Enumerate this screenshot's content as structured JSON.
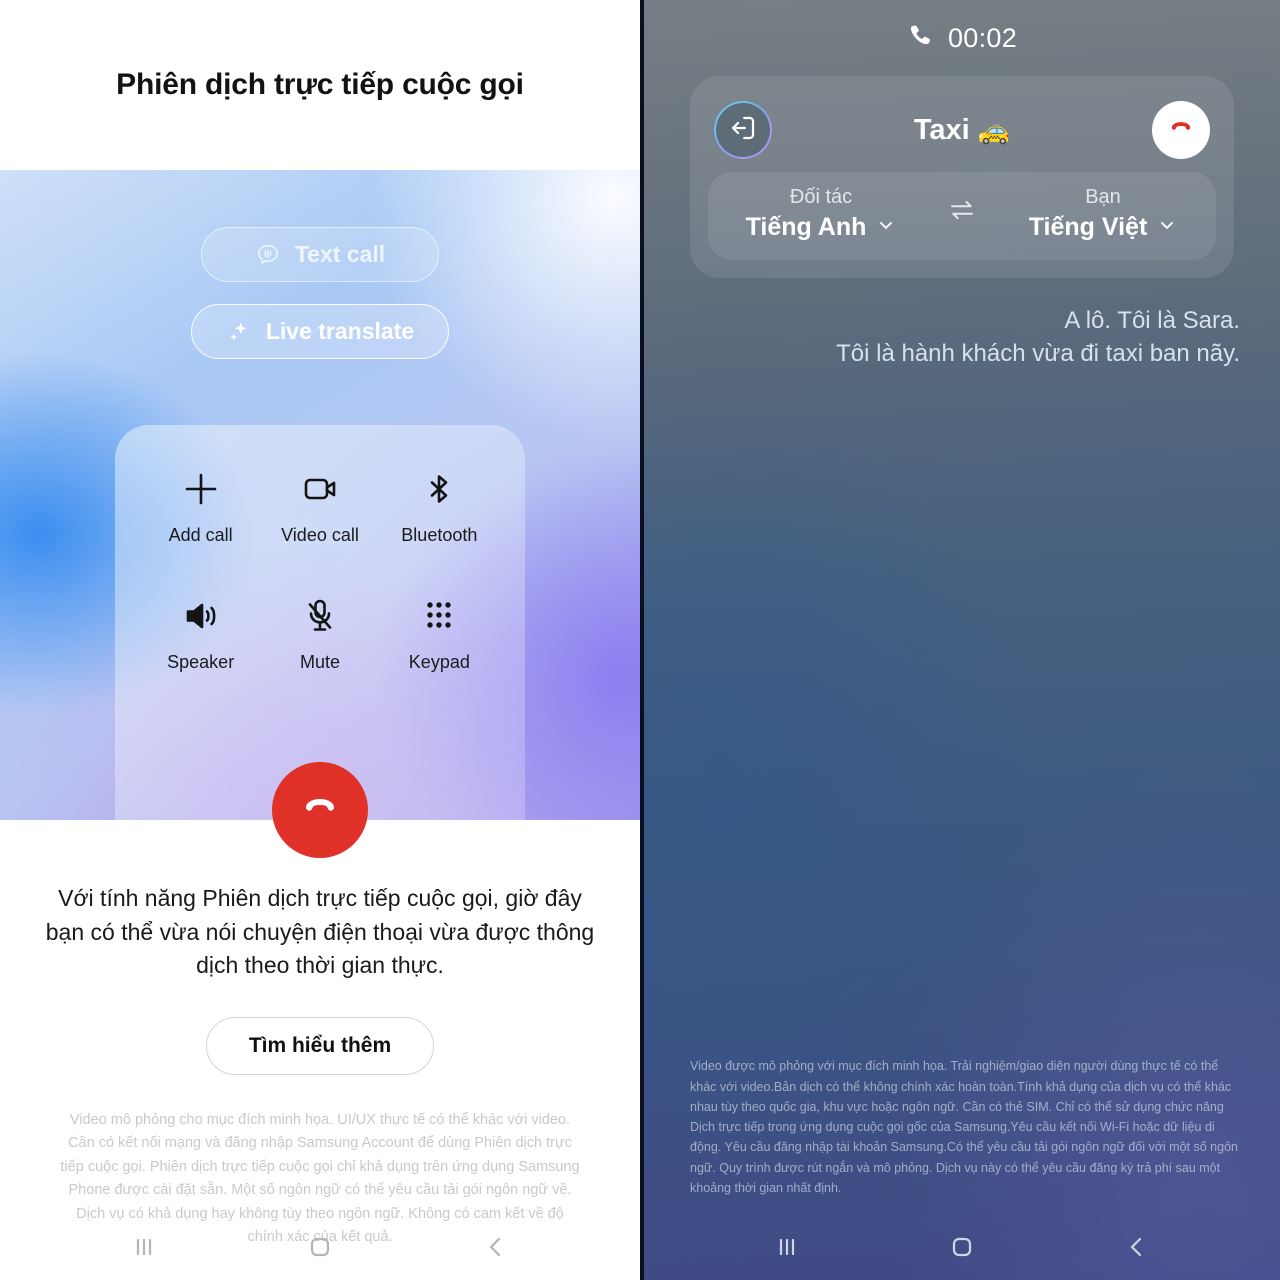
{
  "left": {
    "title": "Phiên dịch trực tiếp cuộc gọi",
    "buttons": {
      "text_call": "Text call",
      "live_translate": "Live translate"
    },
    "controls": [
      {
        "label": "Add call",
        "icon": "plus-icon"
      },
      {
        "label": "Video call",
        "icon": "video-camera-icon"
      },
      {
        "label": "Bluetooth",
        "icon": "bluetooth-icon"
      },
      {
        "label": "Speaker",
        "icon": "speaker-icon"
      },
      {
        "label": "Mute",
        "icon": "microphone-muted-icon"
      },
      {
        "label": "Keypad",
        "icon": "keypad-icon"
      }
    ],
    "hangup_icon": "end-call-icon",
    "description": "Với tính năng Phiên dịch trực tiếp cuộc gọi, giờ đây bạn có thể vừa nói chuyện điện thoại vừa được thông dịch theo thời gian thực.",
    "learn_more": "Tìm hiểu thêm",
    "disclaimer": "Video mô phỏng cho mục đích minh họa. UI/UX thực tế có thể khác với video. Cần có kết nối mạng và đăng nhập Samsung Account để dùng Phiên dịch trực tiếp cuộc gọi. Phiên dịch trực tiếp cuộc gọi chỉ khả dụng trên ứng dụng Samsung Phone được cài đặt sẵn. Một số ngôn ngữ có thể yêu cầu tải gói ngôn ngữ về. Dịch vụ có khả dụng hay không tùy theo ngôn ngữ. Không có cam kết về độ chính xác của kết quả."
  },
  "right": {
    "call_timer": "00:02",
    "timer_icon": "phone-icon",
    "exit_icon": "exit-arrow-icon",
    "caller_name": "Taxi",
    "caller_emoji": "🚕",
    "hangup_icon": "end-call-icon",
    "languages": {
      "partner_role": "Đối tác",
      "partner_language": "Tiếng Anh",
      "you_role": "Bạn",
      "you_language": "Tiếng Việt",
      "swap_icon": "swap-arrows-icon",
      "chevron_icon": "chevron-down-icon"
    },
    "transcript_lines": [
      "A lô. Tôi là Sara.",
      "Tôi là hành khách vừa đi taxi ban nãy."
    ],
    "disclaimer": "Video được mô phỏng với mục đích minh họa. Trải nghiệm/giao diện người dùng thực tế có thể khác với video.Bản dịch có thể không chính xác hoàn toàn.Tính khả dụng của dịch vụ có thể khác nhau tùy theo quốc gia, khu vực hoặc ngôn ngữ. Cần có thẻ SIM. Chỉ có thể sử dụng chức năng Dịch trực tiếp trong ứng dụng cuộc gọi gốc của Samsung.Yêu cầu kết nối Wi-Fi hoặc dữ liệu di động. Yêu cầu đăng nhập tài khoản Samsung.Có thể yêu cầu tải gói ngôn ngữ đối với một số ngôn ngữ. Quy trình được rút ngắn và mô phỏng. Dịch vụ này có thể yêu cầu đăng ký trả phí sau một khoảng thời gian nhất định."
  },
  "navbar": {
    "recents_icon": "recents-icon",
    "home_icon": "home-icon",
    "back_icon": "back-chevron-icon"
  },
  "colors": {
    "accent_red": "#e03128",
    "left_gradient_start": "#cfe0f8",
    "left_gradient_end": "#a89cec",
    "right_gradient_start": "#767f85",
    "right_gradient_end": "#404a86"
  }
}
